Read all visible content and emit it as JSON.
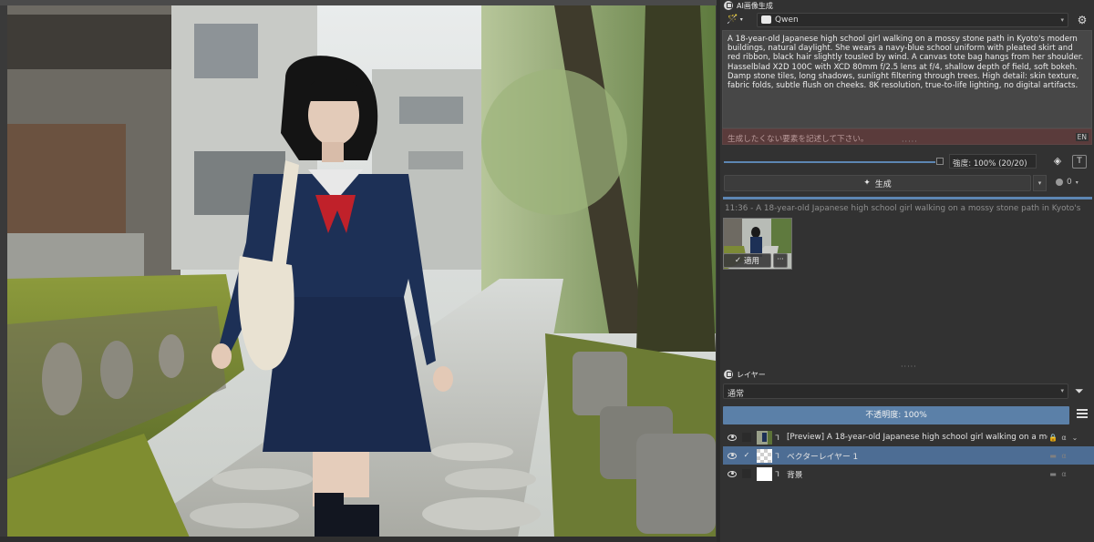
{
  "ai_panel": {
    "title": "AI画像生成",
    "model": "Qwen",
    "prompt": "A 18-year-old Japanese high school girl walking on a mossy stone path in Kyoto's modern buildings, natural daylight. She wears a navy-blue school uniform with pleated skirt and red ribbon, black hair slightly tousled by wind. A canvas tote bag hangs from her shoulder. Hasselblad X2D 100C with XCD 80mm f/2.5 lens at f/4, shallow depth of field, soft bokeh. Damp stone tiles, long shadows, sunlight filtering through trees. High detail: skin texture, fabric folds, subtle flush on cheeks. 8K resolution, true-to-life lighting, no digital artifacts.",
    "negative_placeholder": "生成したくない要素を記述して下さい。",
    "language_badge": "EN",
    "strength_label": "強度: 100% (20/20)",
    "strength_value": 1.0,
    "generate_label": "生成",
    "queue_count": "0",
    "history_caption": "11:36 - A 18-year-old Japanese high school girl walking on a mossy stone path in Kyoto's",
    "apply_label": "適用",
    "more_label": "···"
  },
  "layers_panel": {
    "title": "レイヤー",
    "blend_mode": "通常",
    "opacity_label": "不透明度: 100%",
    "opacity_value": 1.0,
    "layers": [
      {
        "name": "[Preview] A 18-year-old Japanese high school girl walking on a mo...",
        "checked": false,
        "selected": false
      },
      {
        "name": "ベクターレイヤー 1",
        "checked": true,
        "selected": true
      },
      {
        "name": "背景",
        "checked": false,
        "selected": false
      }
    ],
    "check_mark": "✓"
  },
  "colors": {
    "accent": "#5d86b3",
    "selected_layer": "#4d6d94",
    "panel_bg": "#323232",
    "negative_prompt_bg": "#5a3b3b"
  },
  "icons": [
    "wand-icon",
    "gear-icon",
    "layers-icon",
    "text-icon",
    "filter-icon",
    "eye-icon",
    "lock-icon",
    "alpha-icon",
    "menu-icon"
  ]
}
